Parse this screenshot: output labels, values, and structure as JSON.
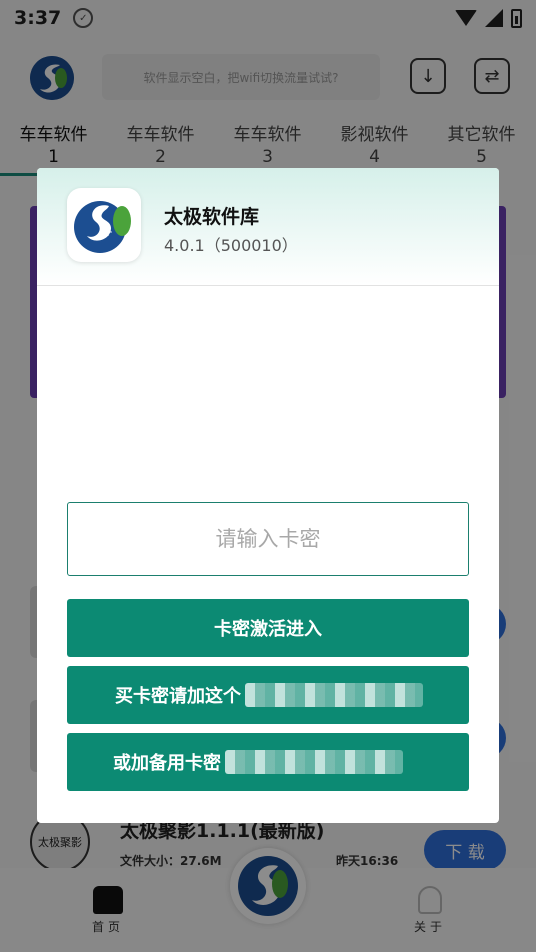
{
  "status_bar": {
    "time": "3:37"
  },
  "header": {
    "search_placeholder": "软件显示空白，把wifi切换流量试试?"
  },
  "tabs": [
    {
      "label": "车车软件",
      "index": "1"
    },
    {
      "label": "车车软件",
      "index": "2"
    },
    {
      "label": "车车软件",
      "index": "3"
    },
    {
      "label": "影视软件",
      "index": "4"
    },
    {
      "label": "其它软件",
      "index": "5"
    }
  ],
  "list": {
    "item": {
      "thumb_text": "太极聚影",
      "title": "太极聚影1.1.1(最新版)",
      "size": "文件大小：27.6M",
      "date": "昨天16:36",
      "download_label": "下 载"
    }
  },
  "bottom_nav": {
    "home_label": "首页",
    "about_label": "关于"
  },
  "dialog": {
    "app_name": "太极软件库",
    "version": "4.0.1（500010）",
    "key_placeholder": "请输入卡密",
    "activate_label": "卡密激活进入",
    "buy_label": "买卡密请加这个",
    "backup_label": "或加备用卡密"
  },
  "colors": {
    "accent": "#0c8a73",
    "download_blue": "#2f6fdb",
    "banner": "#6a3fb3"
  }
}
